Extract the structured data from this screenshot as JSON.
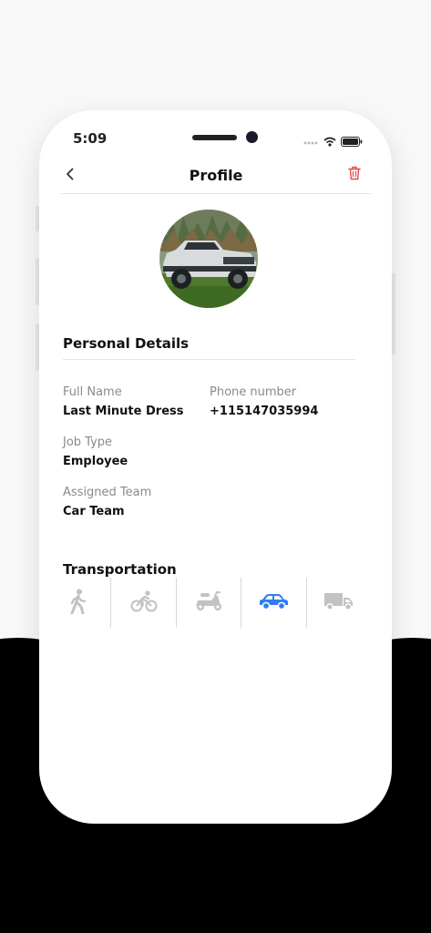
{
  "status_bar": {
    "time": "5:09"
  },
  "header": {
    "title": "Profile",
    "back_icon": "chevron-left-icon",
    "delete_icon": "trash-icon"
  },
  "avatar": {
    "alt": "Profile photo of a pickup truck"
  },
  "personal_details": {
    "title": "Personal Details",
    "fields": [
      {
        "label": "Full Name",
        "value": "Last Minute Dress"
      },
      {
        "label": "Phone number",
        "value": "+115147035994"
      },
      {
        "label": "Job Type",
        "value": "Employee"
      },
      {
        "label": "Assigned Team",
        "value": "Car Team"
      }
    ]
  },
  "transportation": {
    "title": "Transportation",
    "options": [
      {
        "icon": "walking-icon",
        "selected": false
      },
      {
        "icon": "bicycle-icon",
        "selected": false
      },
      {
        "icon": "scooter-icon",
        "selected": false
      },
      {
        "icon": "car-icon",
        "selected": true
      },
      {
        "icon": "truck-icon",
        "selected": false
      }
    ]
  },
  "colors": {
    "accent": "#2f7df6",
    "danger": "#e5484d",
    "inactive_icon": "#c2c2c2",
    "label": "#8a8a8a",
    "text": "#111111"
  }
}
